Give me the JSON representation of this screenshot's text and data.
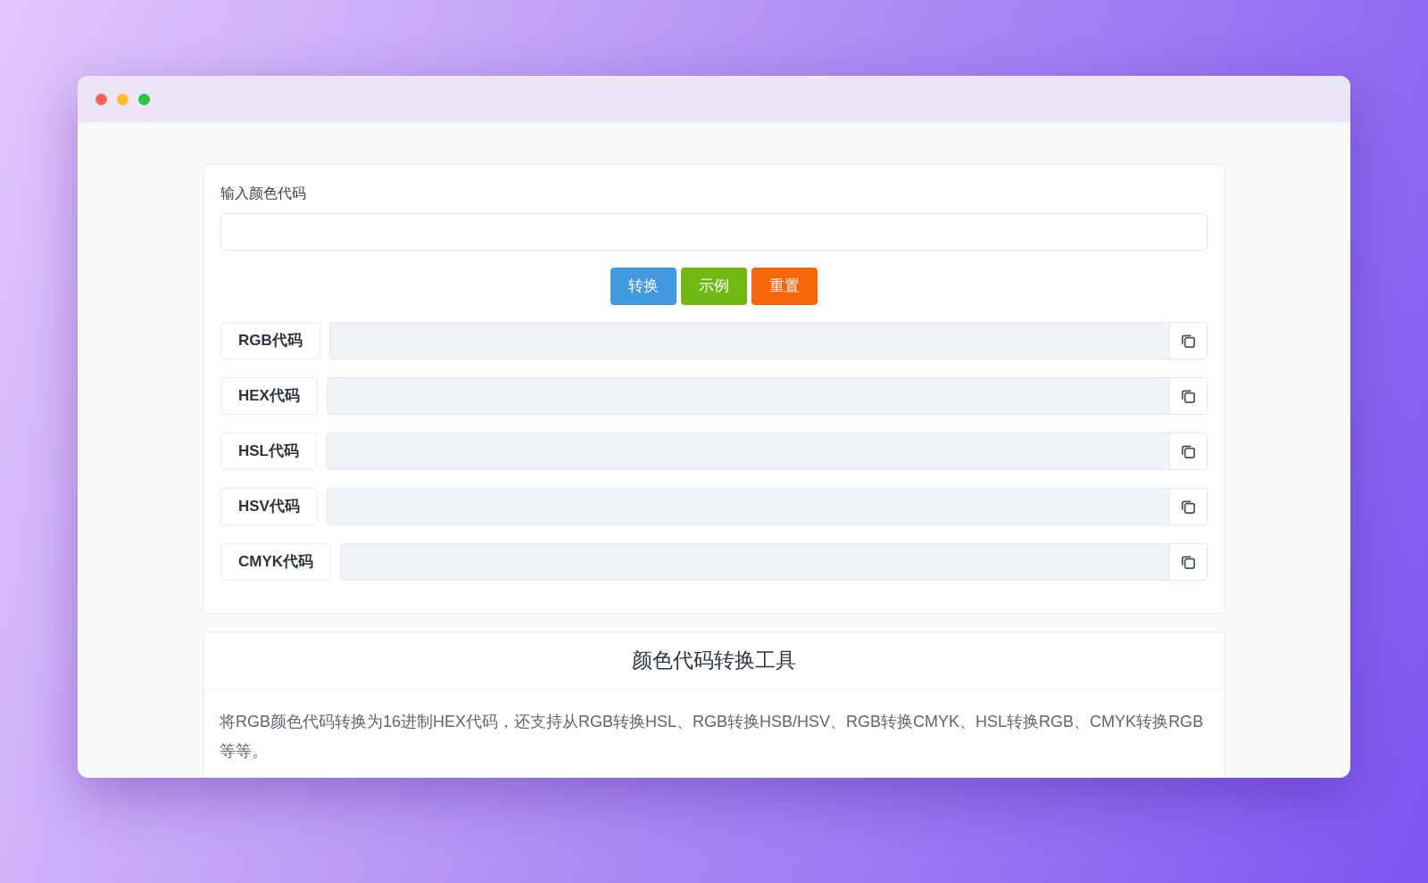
{
  "input": {
    "label": "输入颜色代码"
  },
  "buttons": [
    {
      "label": "转换",
      "color": "#4299e1"
    },
    {
      "label": "示例",
      "color": "#72b814"
    },
    {
      "label": "重置",
      "color": "#f6660a"
    }
  ],
  "outputs": [
    {
      "label": "RGB代码"
    },
    {
      "label": "HEX代码"
    },
    {
      "label": "HSL代码"
    },
    {
      "label": "HSV代码"
    },
    {
      "label": "CMYK代码"
    }
  ],
  "info": {
    "title": "颜色代码转换工具",
    "text": "将RGB颜色代码转换为16进制HEX代码，还支持从RGB转换HSL、RGB转换HSB/HSV、RGB转换CMYK、HSL转换RGB、CMYK转换RGB等等。"
  }
}
